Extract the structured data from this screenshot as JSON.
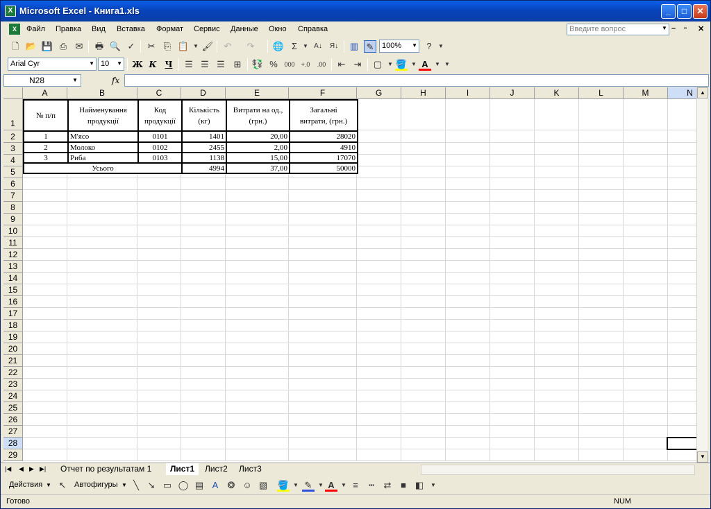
{
  "window": {
    "title": "Microsoft Excel - Книга1.xls",
    "minimize": "_",
    "maximize": "□",
    "close": "✕"
  },
  "menu": [
    "Файл",
    "Правка",
    "Вид",
    "Вставка",
    "Формат",
    "Сервис",
    "Данные",
    "Окно",
    "Справка"
  ],
  "ask": {
    "placeholder": "Введите вопрос"
  },
  "toolbar": {
    "zoom": "100%"
  },
  "format": {
    "font": "Arial Cyr",
    "size": "10",
    "bold": "Ж",
    "italic": "К",
    "underline": "Ч"
  },
  "formula": {
    "namebox": "N28",
    "fx": "fx",
    "content": ""
  },
  "columns": [
    "A",
    "B",
    "C",
    "D",
    "E",
    "F",
    "G",
    "H",
    "I",
    "J",
    "K",
    "L",
    "M",
    "N"
  ],
  "rows": [
    "1",
    "2",
    "3",
    "4",
    "5",
    "6",
    "7",
    "8",
    "9",
    "10",
    "11",
    "12",
    "13",
    "14",
    "15",
    "16",
    "17",
    "18",
    "19",
    "20",
    "21",
    "22",
    "23",
    "24",
    "25",
    "26",
    "27",
    "28",
    "29"
  ],
  "table": {
    "header": {
      "a": [
        "№ п/п"
      ],
      "b": [
        "Найменування",
        "продукції"
      ],
      "c": [
        "Код",
        "продукції"
      ],
      "d": [
        "Кількість",
        "(кг)"
      ],
      "e": [
        "Витрати на од.,",
        "(грн.)"
      ],
      "f": [
        "Загальні",
        "витрати, (грн.)"
      ]
    },
    "rows": [
      {
        "a": "1",
        "b": "М'ясо",
        "c": "0101",
        "d": "1401",
        "e": "20,00",
        "f": "28020"
      },
      {
        "a": "2",
        "b": "Молоко",
        "c": "0102",
        "d": "2455",
        "e": "2,00",
        "f": "4910"
      },
      {
        "a": "3",
        "b": "Риба",
        "c": "0103",
        "d": "1138",
        "e": "15,00",
        "f": "17070"
      }
    ],
    "total": {
      "label": "Усього",
      "d": "4994",
      "e": "37,00",
      "f": "50000"
    }
  },
  "sheets": {
    "tabs": [
      "Отчет по результатам 1",
      "Лист1",
      "Лист2",
      "Лист3"
    ],
    "active": "Лист1"
  },
  "drawing": {
    "actions": "Действия",
    "autoshapes": "Автофигуры"
  },
  "status": {
    "left": "Готово",
    "num": "NUM"
  }
}
